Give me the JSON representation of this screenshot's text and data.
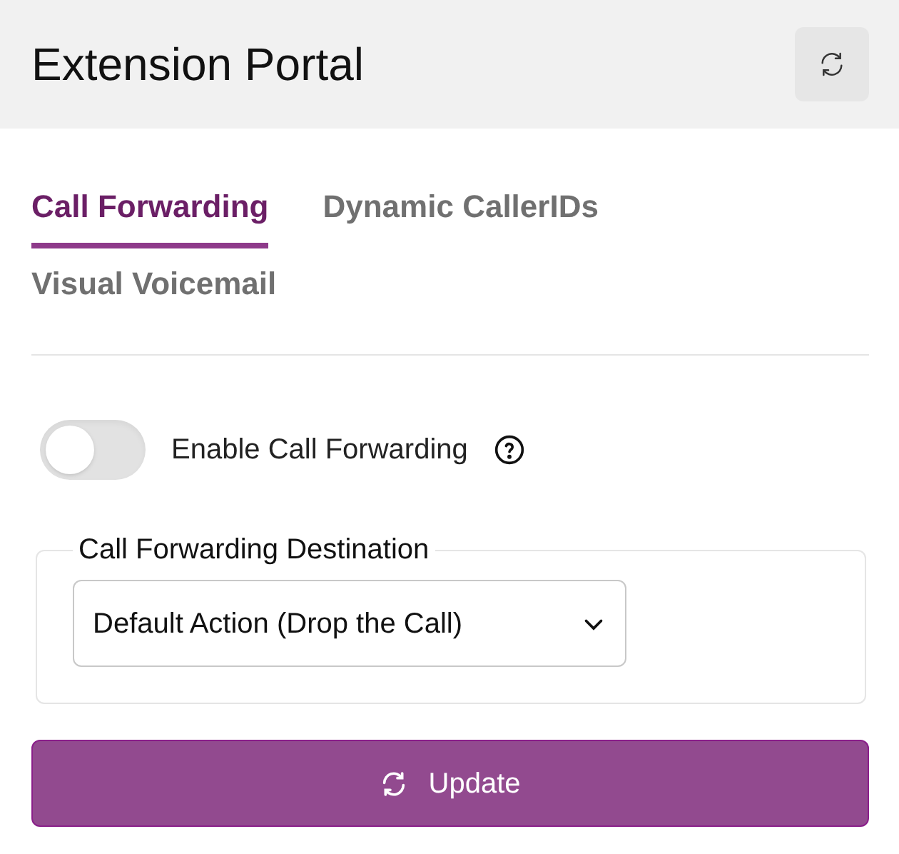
{
  "header": {
    "title": "Extension Portal"
  },
  "tabs": [
    {
      "label": "Call Forwarding",
      "selected": true
    },
    {
      "label": "Dynamic CallerIDs",
      "selected": false
    },
    {
      "label": "Visual Voicemail",
      "selected": false
    }
  ],
  "toggle": {
    "label": "Enable Call Forwarding",
    "on": false
  },
  "destination": {
    "legend": "Call Forwarding Destination",
    "value": "Default Action (Drop the Call)"
  },
  "button": {
    "label": "Update"
  }
}
